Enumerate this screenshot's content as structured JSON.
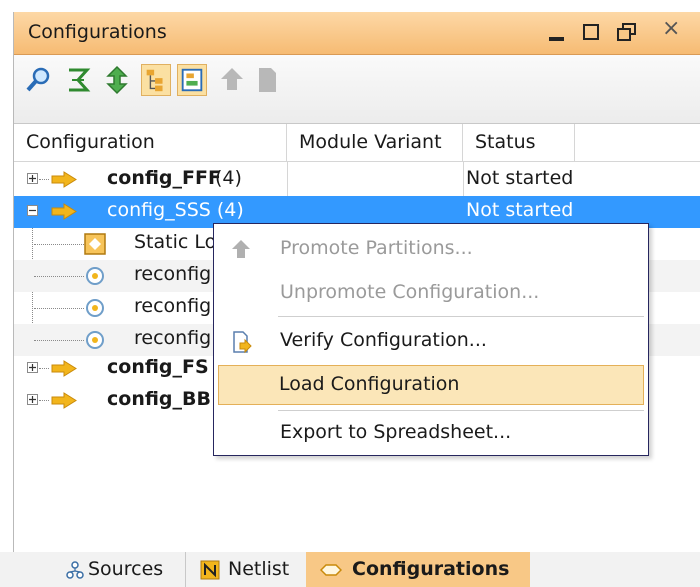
{
  "window": {
    "title": "Configurations",
    "controls": {
      "minimize": "minimize-icon",
      "maximize": "maximize-icon",
      "restore": "restore-icon",
      "close": "close-icon"
    },
    "close_glyph": "×"
  },
  "toolbar": {
    "buttons": [
      {
        "icon": "search-icon",
        "active": false
      },
      {
        "icon": "collapse-all-icon",
        "active": false
      },
      {
        "icon": "expand-all-icon",
        "active": false
      },
      {
        "icon": "hierarchy-icon",
        "active": true
      },
      {
        "icon": "flat-list-icon",
        "active": true
      },
      {
        "icon": "promote-icon",
        "active": false
      },
      {
        "icon": "document-icon",
        "active": false
      }
    ]
  },
  "tree": {
    "columns": [
      "Configuration",
      "Module Variant",
      "Status"
    ],
    "rows": [
      {
        "name": "config_FFF",
        "count": " (4)",
        "status": "Not started",
        "expanded": false,
        "selected": false
      },
      {
        "name": "config_SSS (4)",
        "status": "Not started",
        "expanded": true,
        "selected": true
      },
      {
        "name": "Static Lo"
      },
      {
        "name": "reconfig"
      },
      {
        "name": "reconfig"
      },
      {
        "name": "reconfig"
      },
      {
        "name": "config_FS",
        "expanded": false
      },
      {
        "name": "config_BB",
        "expanded": false
      }
    ]
  },
  "context_menu": {
    "items": [
      {
        "label": "Promote Partitions...",
        "enabled": false,
        "icon": "promote-icon"
      },
      {
        "label": "Unpromote Configuration...",
        "enabled": false
      },
      {
        "label": "Verify Configuration...",
        "enabled": true,
        "icon": "verify-icon"
      },
      {
        "label": "Load Configuration",
        "enabled": true,
        "highlighted": true
      },
      {
        "label": "Export to Spreadsheet...",
        "enabled": true
      }
    ]
  },
  "tabs": [
    {
      "label": "Sources",
      "icon": "sources-icon",
      "active": false
    },
    {
      "label": "Netlist",
      "icon": "netlist-icon",
      "active": false
    },
    {
      "label": "Configurations",
      "icon": "configurations-icon",
      "active": true
    }
  ],
  "colors": {
    "title_bar": "#f6bb73",
    "selection": "#3399ff",
    "menu_highlight": "#fbe6b8",
    "active_tab": "#f8c886",
    "config_arrow": "#f2b51c"
  }
}
